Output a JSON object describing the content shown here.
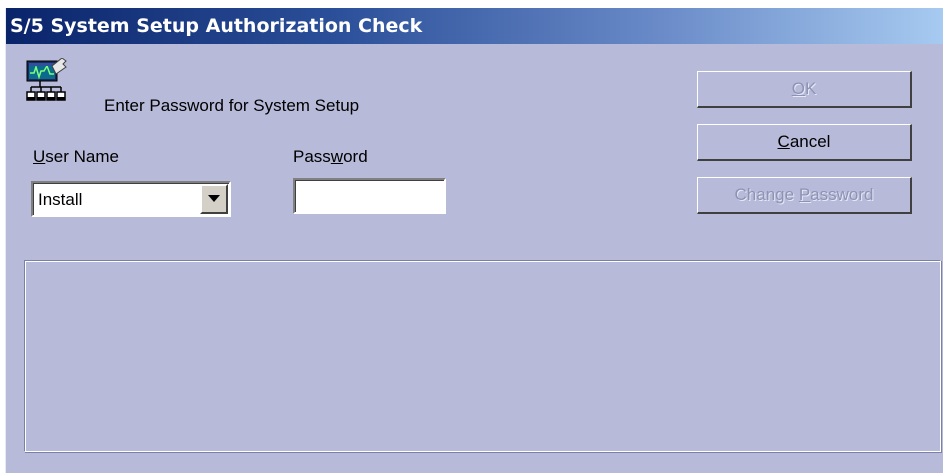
{
  "window": {
    "title": "S/5 System Setup Authorization Check"
  },
  "header": {
    "icon": "system-setup-icon",
    "prompt": "Enter Password for System Setup"
  },
  "form": {
    "user_name": {
      "label_mnemonic": "U",
      "label_rest": "ser Name",
      "value": "Install"
    },
    "password": {
      "label_before": "Pass",
      "label_mnemonic": "w",
      "label_after": "ord",
      "value": ""
    }
  },
  "buttons": {
    "ok": {
      "mnemonic": "O",
      "rest": "K",
      "enabled": false
    },
    "cancel": {
      "mnemonic": "C",
      "rest": "ancel",
      "enabled": true
    },
    "change_password": {
      "before": "Change ",
      "mnemonic": "P",
      "after": "assword",
      "enabled": false
    }
  },
  "message_panel": {
    "text": ""
  },
  "colors": {
    "dialog_bg": "#b7bad9",
    "titlebar_start": "#0a246a",
    "titlebar_end": "#a6caf0",
    "disabled_text": "#8e92b4"
  }
}
